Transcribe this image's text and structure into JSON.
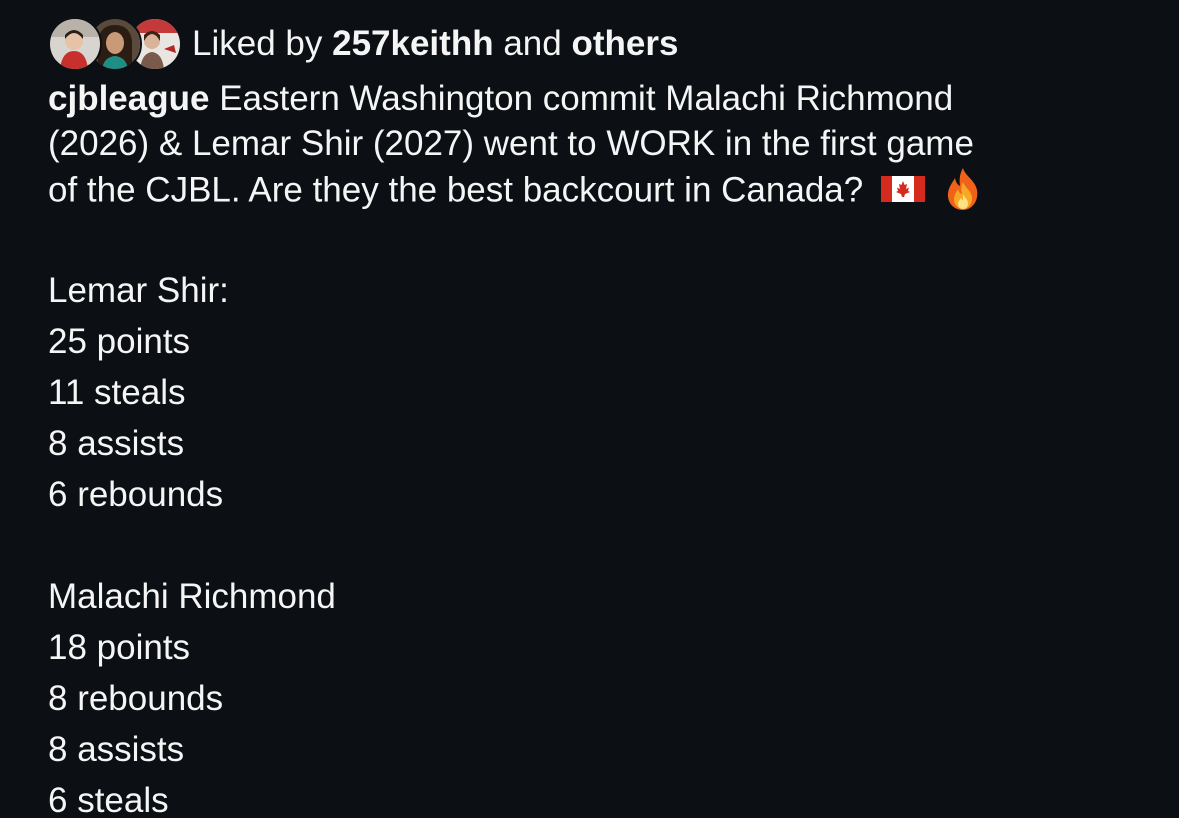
{
  "likes": {
    "prefix": "Liked by",
    "user": "257keithh",
    "connector": "and",
    "others": "others"
  },
  "caption": {
    "username": "cjbleague",
    "line1": "Eastern Washington commit Malachi Richmond",
    "line2": "(2026) & Lemar Shir (2027) went to WORK in the first game",
    "line3": "of the CJBL. Are they the best backcourt in Canada?"
  },
  "players": [
    {
      "heading": "Lemar Shir:",
      "stats": [
        "25 points",
        "11 steals",
        "8 assists",
        "6 rebounds"
      ]
    },
    {
      "heading": "Malachi Richmond",
      "stats": [
        "18 points",
        "8 rebounds",
        "8 assists",
        "6 steals"
      ]
    }
  ],
  "colors": {
    "background": "#0c1014",
    "text": "#f5f5f5"
  },
  "icons": {
    "flag": "canada-flag-emoji",
    "fire": "fire-emoji"
  }
}
